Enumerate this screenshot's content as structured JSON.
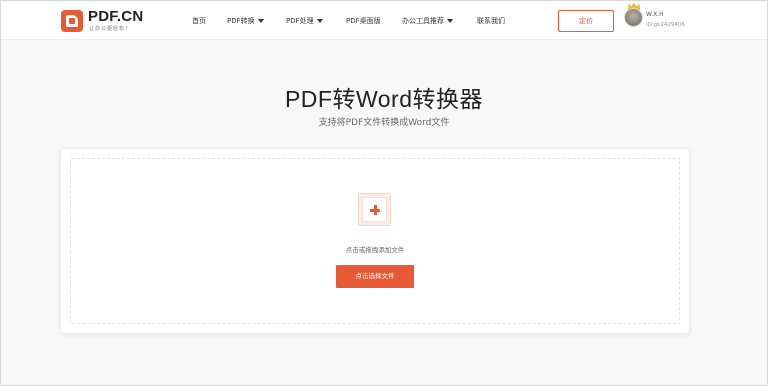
{
  "brand": {
    "logo_text": "PDF.CN",
    "slogan": "让办公更轻松！",
    "accent_color": "#e85a35"
  },
  "nav": {
    "items": [
      {
        "label": "首页",
        "has_dropdown": false
      },
      {
        "label": "PDF转换",
        "has_dropdown": true
      },
      {
        "label": "PDF处理",
        "has_dropdown": true
      },
      {
        "label": "PDF桌面版",
        "has_dropdown": false
      },
      {
        "label": "办公工具推荐",
        "has_dropdown": true
      },
      {
        "label": "联系我们",
        "has_dropdown": false
      }
    ],
    "pricing_label": "定价"
  },
  "user": {
    "name": "W.X.H",
    "id": "ID:gk2429406",
    "avatar_icon": "user-avatar",
    "badge_icon": "crown-icon"
  },
  "main": {
    "title": "PDF转Word转换器",
    "subtitle": "支持将PDF文件转换成Word文件",
    "upload": {
      "icon": "plus-icon",
      "hint": "点击或拖拽添加文件",
      "button_label": "点击选择文件"
    }
  }
}
